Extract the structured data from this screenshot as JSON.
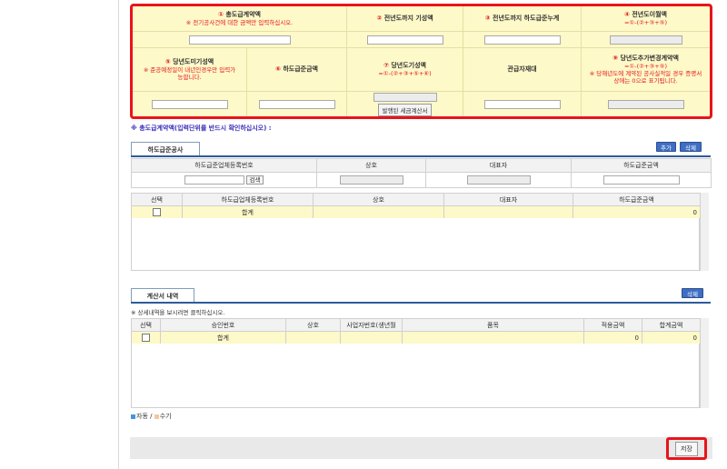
{
  "top_grid": {
    "total_contract": {
      "num": "①",
      "label": "총도급계약액",
      "note": "※ 전기공사건에 대한 금액만 입력하십시오."
    },
    "prev_progress": {
      "num": "②",
      "label": "전년도까지 기성액"
    },
    "prev_subcontract": {
      "num": "③",
      "label": "전년도까지 하도급준누계"
    },
    "prev_remaining": {
      "num": "④",
      "label": "전년도이월액",
      "formula": "=①-(②+③+⑤)"
    },
    "curr_unprogressed": {
      "num": "⑤",
      "label": "당년도미기성액",
      "note": "※ 준공예정일이 내년인경우만 입력가능합니다."
    },
    "sub_amount": {
      "num": "⑥",
      "label": "하도급준금액"
    },
    "curr_progress": {
      "num": "⑦",
      "label": "당년도기성액",
      "formula": "=①-(②+③+⑤+⑥)"
    },
    "issuer": {
      "label": "관급자재대"
    },
    "curr_extra": {
      "num": "⑨",
      "label": "당년도추가변경계약액",
      "formula": "=①-(②+③+⑤)",
      "note": "※ 당해년도에 계약된 공사실적일 경우 증명서 상에는 0으로 표기됩니다."
    },
    "issued_invoice_button": "발행된 세금계산서"
  },
  "warning_note": "※ 총도급계약액(입력단위를 반드시 확인하십시오) :",
  "subcontract": {
    "tab": "하도급준공사",
    "add_button": "추가",
    "delete_button": "삭제",
    "input_headers": [
      "하도급준업체등록번호",
      "상호",
      "대표자",
      "하도급준금액"
    ],
    "search_button": "검색",
    "table_headers": [
      "선택",
      "하도급업체등록번호",
      "상호",
      "대표자",
      "하도급준금액"
    ],
    "total_row": {
      "label": "합계",
      "amount": "0"
    }
  },
  "invoice": {
    "tab": "계산서 내역",
    "delete_button": "삭제",
    "hint": "※ 상세내역을 보시려면 클릭하십시오.",
    "table_headers": [
      "선택",
      "승인번호",
      "상호",
      "사업자번호(생년월",
      "품목",
      "적용금액",
      "합계금액"
    ],
    "total_row": {
      "label": "합계",
      "applied": "0",
      "total": "0"
    }
  },
  "legend": {
    "auto": "자동",
    "sep": " / ",
    "manual": "수기"
  },
  "colors": {
    "auto": "#4a90e2",
    "manual": "#f4c7a0",
    "highlight": "#e8141c"
  },
  "save_button": "저장"
}
